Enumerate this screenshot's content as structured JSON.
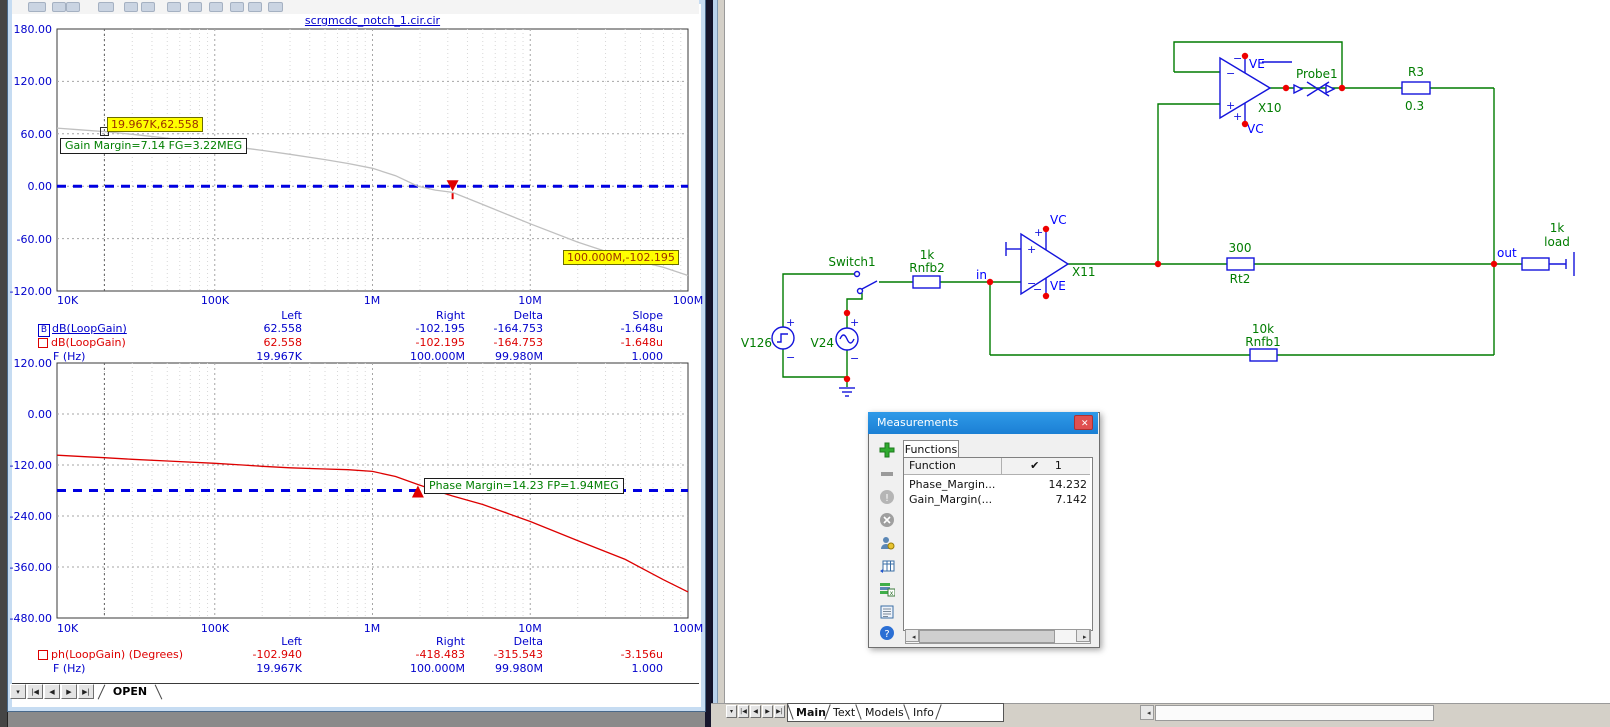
{
  "colors": {
    "plot_text_blue": "#0000cc",
    "curve_gray": "#c0c0c0",
    "curve_red": "#dd0000",
    "ref_line_blue": "#0000e0",
    "annotation_green": "#007f00",
    "cursor_yellow": "#ffff00",
    "wire_green": "#007c00",
    "component_blue": "#1414dc",
    "node_dot_red": "#ee0000",
    "dialog_titlebar_blue": "#2492e6",
    "close_button_red": "#e05050"
  },
  "plot_window": {
    "title": "scrgmcdc_notch_1.cir.cir",
    "sheet_tab": "OPEN",
    "nav_buttons": [
      "▾",
      "|◀",
      "◀",
      "▶",
      "▶|"
    ],
    "gain_plot": {
      "y_ticks": [
        "180.00",
        "120.00",
        "60.00",
        "0.00",
        "-60.00",
        "-120.00"
      ],
      "x_ticks": [
        "10K",
        "100K",
        "1M",
        "10M",
        "100M"
      ],
      "cursor_box_left": "19.967K,62.558",
      "cursor_box_right": "100.000M,-102.195",
      "annotation": "Gain Margin=7.14 FG=3.22MEG",
      "table": {
        "headers": [
          "Left",
          "Right",
          "Delta",
          "Slope"
        ],
        "rows": [
          {
            "badge": "B",
            "label": "dB(LoopGain)",
            "values": [
              "62.558",
              "-102.195",
              "-164.753",
              "-1.648u"
            ]
          },
          {
            "label": "dB(LoopGain)",
            "values": [
              "62.558",
              "-102.195",
              "-164.753",
              "-1.648u"
            ]
          },
          {
            "label": "F (Hz)",
            "values": [
              "19.967K",
              "100.000M",
              "99.980M",
              "1.000"
            ]
          }
        ]
      }
    },
    "phase_plot": {
      "y_ticks": [
        "120.00",
        "0.00",
        "-120.00",
        "-240.00",
        "-360.00",
        "-480.00"
      ],
      "x_ticks": [
        "10K",
        "100K",
        "1M",
        "10M",
        "100M"
      ],
      "annotation": "Phase Margin=14.23 FP=1.94MEG",
      "table": {
        "headers": [
          "Left",
          "Right",
          "Delta",
          "Slope"
        ],
        "rows": [
          {
            "label": "ph(LoopGain) (Degrees)",
            "values": [
              "-102.940",
              "-418.483",
              "-315.543",
              "-3.156u"
            ]
          },
          {
            "label": "F (Hz)",
            "values": [
              "19.967K",
              "100.000M",
              "99.980M",
              "1.000"
            ]
          }
        ]
      }
    }
  },
  "chart_data": [
    {
      "type": "line",
      "title": "scrgmcdc_notch_1.cir.cir",
      "xlabel": "F (Hz)",
      "ylabel": "dB(LoopGain)",
      "xscale": "log",
      "xlim": [
        10000,
        100000000
      ],
      "ylim": [
        -120,
        180
      ],
      "grid": true,
      "ref_line_y": 0,
      "cursor_vline_f": 19967,
      "marker": {
        "f": 3220000,
        "y": 0,
        "label": "Gain Margin=7.14 FG=3.22MEG"
      },
      "cursors": [
        {
          "f": 19967,
          "value": 62.558
        },
        {
          "f": 100000000,
          "value": -102.195
        }
      ],
      "series": [
        {
          "name": "dB(LoopGain)",
          "color": "#c0c0c0",
          "points": [
            [
              10000,
              66.5
            ],
            [
              14000,
              64.6
            ],
            [
              19967,
              62.558
            ],
            [
              30000,
              59.4
            ],
            [
              50000,
              55.0
            ],
            [
              70000,
              51.8
            ],
            [
              100000,
              48.0
            ],
            [
              150000,
              44.0
            ],
            [
              200000,
              41.0
            ],
            [
              300000,
              36.5
            ],
            [
              500000,
              30.5
            ],
            [
              700000,
              26.0
            ],
            [
              1000000,
              20.5
            ],
            [
              1400000,
              12.0
            ],
            [
              1940000,
              0.0
            ],
            [
              2500000,
              -4.5
            ],
            [
              3220000,
              -7.14
            ],
            [
              5000000,
              -21.0
            ],
            [
              10000000,
              -43.0
            ],
            [
              20000000,
              -64.0
            ],
            [
              40000000,
              -82.0
            ],
            [
              70000000,
              -93.0
            ],
            [
              100000000,
              -102.195
            ]
          ]
        }
      ]
    },
    {
      "type": "line",
      "title": "scrgmcdc_notch_1.cir.cir",
      "xlabel": "F (Hz)",
      "ylabel": "ph(LoopGain) (Degrees)",
      "xscale": "log",
      "xlim": [
        10000,
        100000000
      ],
      "ylim": [
        -480,
        120
      ],
      "grid": true,
      "ref_line_y": -180,
      "cursor_vline_f": 19967,
      "marker": {
        "f": 1940000,
        "y": -180,
        "label": "Phase Margin=14.23 FP=1.94MEG"
      },
      "cursors": [
        {
          "f": 19967,
          "value": -102.94
        },
        {
          "f": 100000000,
          "value": -418.483
        }
      ],
      "series": [
        {
          "name": "ph(LoopGain)",
          "color": "#dd0000",
          "points": [
            [
              10000,
              -97.0
            ],
            [
              15000,
              -100.5
            ],
            [
              19967,
              -102.94
            ],
            [
              30000,
              -106.5
            ],
            [
              50000,
              -110.5
            ],
            [
              100000,
              -116.0
            ],
            [
              150000,
              -120.0
            ],
            [
              200000,
              -123.0
            ],
            [
              300000,
              -126.5
            ],
            [
              500000,
              -129.5
            ],
            [
              700000,
              -131.0
            ],
            [
              1000000,
              -135.0
            ],
            [
              1400000,
              -147.0
            ],
            [
              1940000,
              -165.8
            ],
            [
              2500000,
              -180.0
            ],
            [
              3220000,
              -193.0
            ],
            [
              5000000,
              -213.0
            ],
            [
              10000000,
              -253.0
            ],
            [
              20000000,
              -298.0
            ],
            [
              40000000,
              -342.0
            ],
            [
              70000000,
              -390.0
            ],
            [
              100000000,
              -418.483
            ]
          ]
        }
      ]
    }
  ],
  "schematic_window": {
    "tabs": [
      "Main",
      "Text",
      "Models",
      "Info"
    ],
    "nav_buttons": [
      "▾",
      "|◀",
      "◀",
      "▶",
      "▶|"
    ],
    "scroll_left_arrow": "◂",
    "components": {
      "x10": {
        "name": "X10",
        "pin_top": "VE",
        "pin_bottom": "VC"
      },
      "x11": {
        "name": "X11",
        "pin_top": "VC",
        "pin_bottom": "VE"
      },
      "probe": {
        "name": "Probe1"
      },
      "r3": {
        "name": "R3",
        "value": "0.3"
      },
      "rt2": {
        "name": "Rt2",
        "value": "300"
      },
      "rnfb1": {
        "name": "Rnfb1",
        "value": "10k"
      },
      "rnfb2": {
        "name": "Rnfb2",
        "value": "1k"
      },
      "load": {
        "name": "load",
        "value": "1k"
      },
      "switch": {
        "name": "Switch1"
      },
      "v126": {
        "name": "V126"
      },
      "v24": {
        "name": "V24"
      }
    },
    "nodes": {
      "in": "in",
      "out": "out"
    },
    "signs": {
      "plus": "+",
      "minus": "−"
    }
  },
  "measurements_dialog": {
    "title": "Measurements",
    "close": "✕",
    "tab": "Functions",
    "table": {
      "col1": "Function",
      "col2_check": "✔",
      "col2": "1",
      "rows": [
        {
          "function": "Phase_Margin...",
          "value": "14.232"
        },
        {
          "function": "Gain_Margin(...",
          "value": "7.142"
        }
      ]
    }
  }
}
